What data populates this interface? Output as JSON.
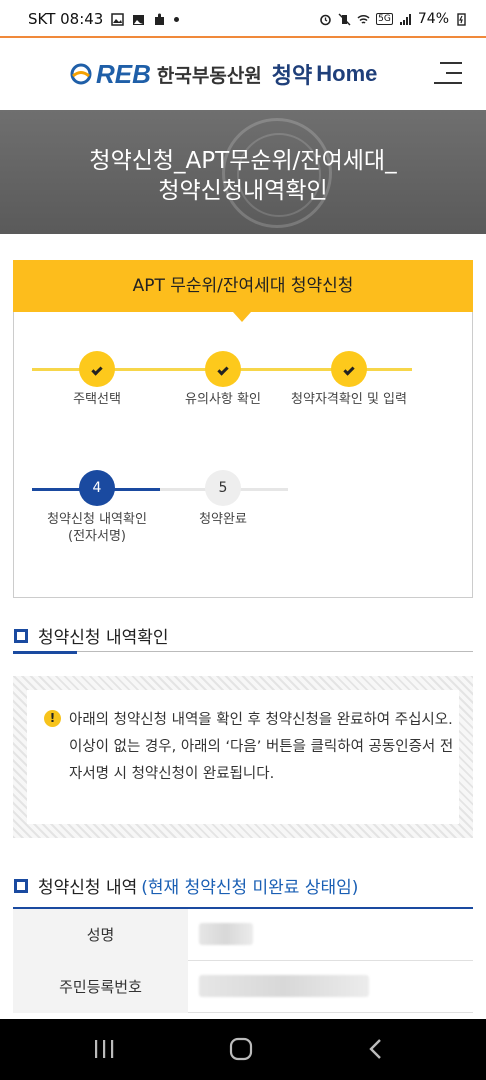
{
  "status_bar": {
    "carrier_time": "SKT 08:43",
    "battery": "74%",
    "network": "5G"
  },
  "header": {
    "logo_reb": "REB",
    "logo_org": "한국부동산원",
    "logo_service": "청약",
    "logo_home": "Home"
  },
  "banner": {
    "title_line1": "청약신청_APT무순위/잔여세대_",
    "title_line2": "청약신청내역확인"
  },
  "steps_card": {
    "title": "APT 무순위/잔여세대 청약신청",
    "steps": [
      {
        "number": "1",
        "label": "주택선택",
        "state": "done"
      },
      {
        "number": "2",
        "label": "유의사항 확인",
        "state": "done"
      },
      {
        "number": "3",
        "label": "청약자격확인 및 입력",
        "state": "done"
      },
      {
        "number": "4",
        "label": "청약신청 내역확인 (전자서명)",
        "state": "current"
      },
      {
        "number": "5",
        "label": "청약완료",
        "state": "pending"
      }
    ]
  },
  "section1": {
    "title": "청약신청 내역확인"
  },
  "notice": {
    "text": "아래의 청약신청 내역을 확인 후 청약신청을 완료하여 주십시오. 이상이 없는 경우, 아래의 ‘다음’ 버튼을 클릭하여 공동인증서 전자서명 시 청약신청이 완료됩니다."
  },
  "section2": {
    "title": "청약신청 내역",
    "status": "(현재 청약신청 미완료 상태임)"
  },
  "table": {
    "rows": [
      {
        "label": "성명"
      },
      {
        "label": "주민등록번호"
      }
    ]
  },
  "colors": {
    "accent_yellow": "#fdbd1c",
    "primary_blue": "#1a4aa0",
    "status_blue": "#1a5fb4"
  }
}
